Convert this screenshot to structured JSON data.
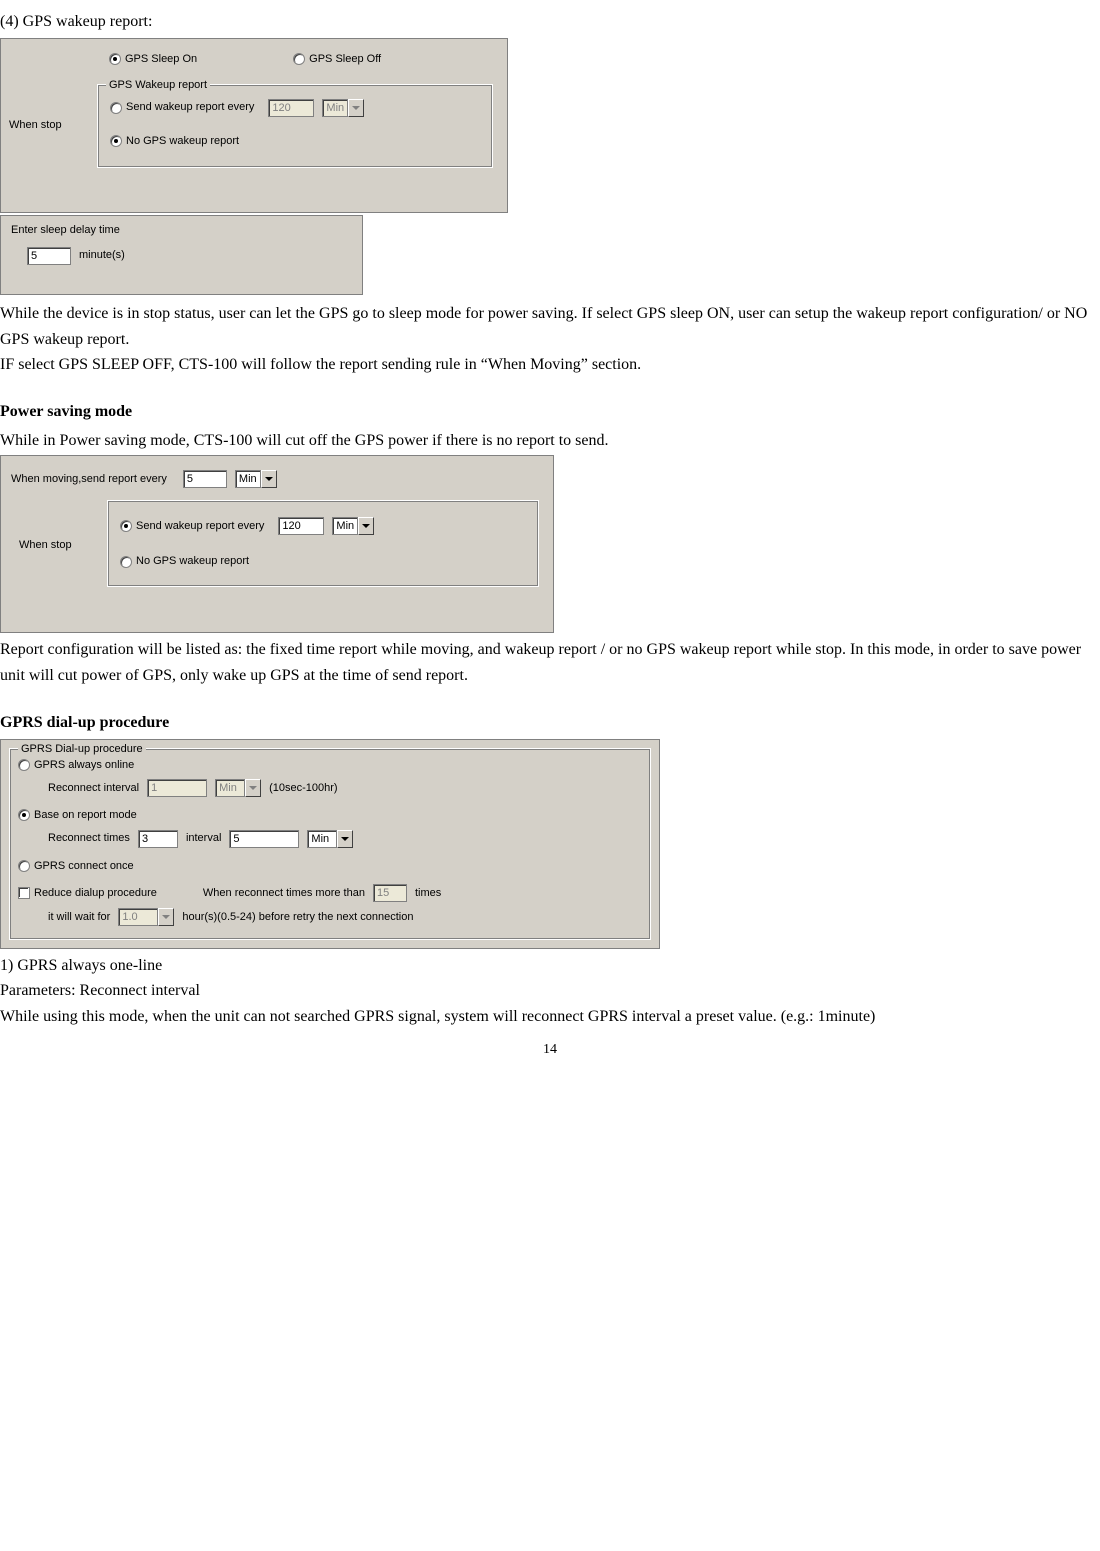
{
  "section4_title": "(4) GPS wakeup report:",
  "panel1": {
    "when_stop_label": "When stop",
    "sleep_on_label": "GPS Sleep On",
    "sleep_off_label": "GPS Sleep Off",
    "fieldset_title": "GPS Wakeup report",
    "send_every_label": "Send wakeup report every",
    "send_every_value": "120",
    "send_every_unit": "Min",
    "no_report_label": "No GPS wakeup report"
  },
  "panel2": {
    "title": "Enter sleep delay time",
    "value": "5",
    "unit": "minute(s)"
  },
  "para_after_panel12_a": "While the device is in stop status, user can let the GPS go to sleep mode for power saving. If select GPS sleep ON, user can setup the wakeup report configuration/ or NO GPS wakeup report.",
  "para_after_panel12_b": "IF select GPS SLEEP OFF, CTS-100 will follow the report sending rule in “When Moving” section.",
  "psm_heading": "Power saving mode",
  "psm_intro": "While in Power saving mode, CTS-100 will cut off the GPS power if there is no report to send.",
  "panel3": {
    "moving_label": "When moving,send report every",
    "moving_value": "5",
    "moving_unit": "Min",
    "when_stop_label": "When stop",
    "send_every_label": "Send wakeup report every",
    "send_every_value": "120",
    "send_every_unit": "Min",
    "no_report_label": "No GPS wakeup report"
  },
  "psm_after": "Report configuration will be listed as: the fixed time report while moving, and wakeup report / or no GPS wakeup report while stop. In this mode, in order to save power unit will cut power of GPS, only wake up GPS at the time of send report.",
  "gprs_heading": "GPRS dial-up procedure",
  "panel4": {
    "fieldset_title": "GPRS Dial-up procedure",
    "opt_always": "GPRS always online",
    "reconnect_interval_label": "Reconnect interval",
    "reconnect_interval_value": "1",
    "reconnect_interval_unit": "Min",
    "reconnect_interval_range": "(10sec-100hr)",
    "opt_report": "Base on report mode",
    "reconnect_times_label": "Reconnect times",
    "reconnect_times_value": "3",
    "interval_label": "interval",
    "interval_value": "5",
    "interval_unit": "Min",
    "opt_once": "GPRS connect once",
    "reduce_label": "Reduce dialup procedure",
    "reduce_text_a": "When reconnect times more than",
    "reduce_times_value": "15",
    "reduce_text_b": "times",
    "reduce_text_c": "it will wait for",
    "reduce_wait_value": "1.0",
    "reduce_text_d": "hour(s)(0.5-24) before retry the next connection"
  },
  "gprs_item1": "1) GPRS always one-line",
  "gprs_item1_params": "Parameters: Reconnect interval",
  "gprs_item1_desc": "While using this mode, when the unit can not searched GPRS signal, system will reconnect GPRS interval a preset value. (e.g.: 1minute)",
  "page_number": "14"
}
